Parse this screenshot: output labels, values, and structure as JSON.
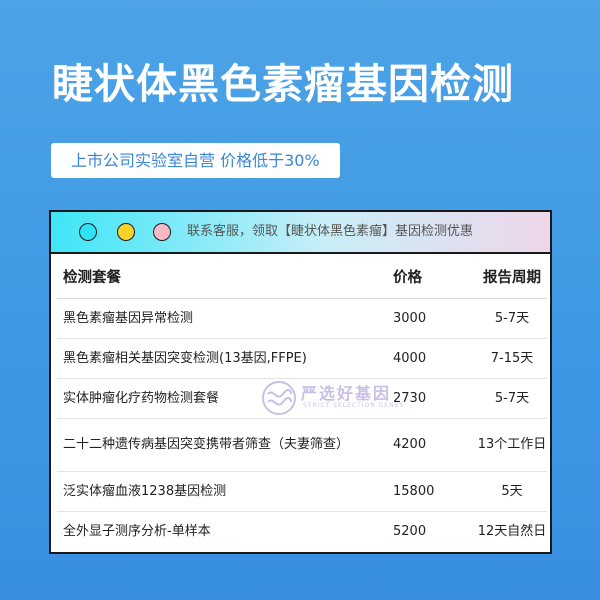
{
  "page": {
    "title": "睫状体黑色素瘤基因检测",
    "subtitle": "上市公司实验室自营 价格低于30%"
  },
  "window": {
    "dots": [
      {
        "color": "#2ee1f5"
      },
      {
        "color": "#f7d22b"
      },
      {
        "color": "#f7b9c8"
      }
    ],
    "bar_text": "联系客服，领取【睫状体黑色素瘤】基因检测优惠"
  },
  "table": {
    "headers": [
      "检测套餐",
      "价格",
      "报告周期"
    ],
    "rows": [
      {
        "name": "黑色素瘤基因异常检测",
        "price": "3000",
        "period": "5-7天"
      },
      {
        "name": "黑色素瘤相关基因突变检测(13基因,FFPE)",
        "price": "4000",
        "period": "7-15天"
      },
      {
        "name": "实体肿瘤化疗药物检测套餐",
        "price": "2730",
        "period": "5-7天"
      },
      {
        "name": "二十二种遗传病基因突变携带者筛查（夫妻筛查）",
        "price": "4200",
        "period": "13个工作日"
      },
      {
        "name": "泛实体瘤血液1238基因检测",
        "price": "15800",
        "period": "5天"
      },
      {
        "name": "全外显子测序分析-单样本",
        "price": "5200",
        "period": "12天自然日"
      }
    ]
  },
  "watermark": {
    "text": "严选好基因",
    "sub": "STRICT SELECTION GENES",
    "icon": "dna-logo-icon"
  }
}
